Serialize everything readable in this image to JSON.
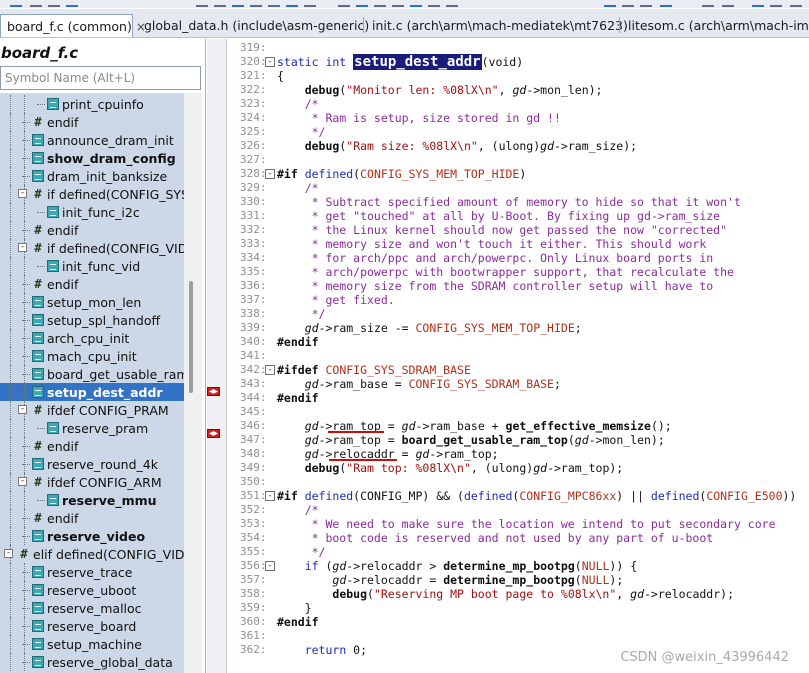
{
  "tabs": [
    {
      "label": "board_f.c (common)",
      "close": "×",
      "active": true
    },
    {
      "label": "global_data.h (include\\asm-generic)",
      "active": false
    },
    {
      "label": "init.c (arch\\arm\\mach-mediatek\\mt7623)",
      "active": false
    },
    {
      "label": "litesom.c (arch\\arm\\mach-imx\\m",
      "active": false
    }
  ],
  "symbol_panel": {
    "title": "board_f.c",
    "search_placeholder": "Symbol Name (Alt+L)",
    "items": [
      {
        "label": "print_cpuinfo",
        "kind": "function",
        "depth": 2,
        "bold": false,
        "selected": false
      },
      {
        "label": "endif",
        "kind": "preproc",
        "depth": 1,
        "bold": false,
        "selected": false
      },
      {
        "label": "announce_dram_init",
        "kind": "function",
        "depth": 1,
        "bold": false,
        "selected": false
      },
      {
        "label": "show_dram_config",
        "kind": "function",
        "depth": 1,
        "bold": true,
        "selected": false
      },
      {
        "label": "dram_init_banksize",
        "kind": "function",
        "depth": 1,
        "bold": false,
        "selected": false
      },
      {
        "label": "if defined(CONFIG_SYS_",
        "kind": "preproc",
        "depth": 1,
        "bold": false,
        "selected": false,
        "toggle": "-"
      },
      {
        "label": "init_func_i2c",
        "kind": "function",
        "depth": 2,
        "bold": false,
        "selected": false
      },
      {
        "label": "endif",
        "kind": "preproc",
        "depth": 1,
        "bold": false,
        "selected": false
      },
      {
        "label": "if defined(CONFIG_VID)",
        "kind": "preproc",
        "depth": 1,
        "bold": false,
        "selected": false,
        "toggle": "-"
      },
      {
        "label": "init_func_vid",
        "kind": "function",
        "depth": 2,
        "bold": false,
        "selected": false
      },
      {
        "label": "endif",
        "kind": "preproc",
        "depth": 1,
        "bold": false,
        "selected": false
      },
      {
        "label": "setup_mon_len",
        "kind": "function",
        "depth": 1,
        "bold": false,
        "selected": false
      },
      {
        "label": "setup_spl_handoff",
        "kind": "function",
        "depth": 1,
        "bold": false,
        "selected": false
      },
      {
        "label": "arch_cpu_init",
        "kind": "function",
        "depth": 1,
        "bold": false,
        "selected": false
      },
      {
        "label": "mach_cpu_init",
        "kind": "function",
        "depth": 1,
        "bold": false,
        "selected": false
      },
      {
        "label": "board_get_usable_ram_",
        "kind": "function",
        "depth": 1,
        "bold": false,
        "selected": false
      },
      {
        "label": "setup_dest_addr",
        "kind": "function",
        "depth": 1,
        "bold": true,
        "selected": true
      },
      {
        "label": "ifdef CONFIG_PRAM",
        "kind": "preproc",
        "depth": 1,
        "bold": false,
        "selected": false,
        "toggle": "-"
      },
      {
        "label": "reserve_pram",
        "kind": "function",
        "depth": 2,
        "bold": false,
        "selected": false
      },
      {
        "label": "endif",
        "kind": "preproc",
        "depth": 1,
        "bold": false,
        "selected": false
      },
      {
        "label": "reserve_round_4k",
        "kind": "function",
        "depth": 1,
        "bold": false,
        "selected": false
      },
      {
        "label": "ifdef CONFIG_ARM",
        "kind": "preproc",
        "depth": 1,
        "bold": false,
        "selected": false,
        "toggle": "-"
      },
      {
        "label": "reserve_mmu",
        "kind": "function",
        "depth": 2,
        "bold": true,
        "selected": false
      },
      {
        "label": "endif",
        "kind": "preproc",
        "depth": 1,
        "bold": false,
        "selected": false
      },
      {
        "label": "reserve_video",
        "kind": "function",
        "depth": 1,
        "bold": true,
        "selected": false
      },
      {
        "label": "elif defined(CONFIG_VIDEO",
        "kind": "preproc",
        "depth": 0,
        "bold": false,
        "selected": false,
        "toggle": "-"
      },
      {
        "label": "reserve_trace",
        "kind": "function",
        "depth": 1,
        "bold": false,
        "selected": false
      },
      {
        "label": "reserve_uboot",
        "kind": "function",
        "depth": 1,
        "bold": false,
        "selected": false
      },
      {
        "label": "reserve_malloc",
        "kind": "function",
        "depth": 1,
        "bold": false,
        "selected": false
      },
      {
        "label": "reserve_board",
        "kind": "function",
        "depth": 1,
        "bold": false,
        "selected": false
      },
      {
        "label": "setup_machine",
        "kind": "function",
        "depth": 1,
        "bold": false,
        "selected": false
      },
      {
        "label": "reserve_global_data",
        "kind": "function",
        "depth": 1,
        "bold": false,
        "selected": false
      }
    ]
  },
  "code": [
    {
      "n": "319:",
      "segs": []
    },
    {
      "n": "320:",
      "fold": "-",
      "segs": [
        [
          "kw",
          "static int "
        ],
        [
          "hl",
          "setup_dest_addr"
        ],
        [
          "p",
          "(void)"
        ]
      ]
    },
    {
      "n": "321:",
      "segs": [
        [
          "p",
          "{"
        ]
      ]
    },
    {
      "n": "322:",
      "segs": [
        [
          "p",
          "    "
        ],
        [
          "fn",
          "debug"
        ],
        [
          "p",
          "("
        ],
        [
          "str",
          "\"Monitor len: %08lX\\n\""
        ],
        [
          "p",
          ", "
        ],
        [
          "gd",
          "gd"
        ],
        [
          "p",
          "->mon_len);"
        ]
      ]
    },
    {
      "n": "323:",
      "segs": [
        [
          "cm",
          "    /*"
        ]
      ]
    },
    {
      "n": "324:",
      "segs": [
        [
          "cm",
          "     * Ram is setup, size stored in gd !!"
        ]
      ]
    },
    {
      "n": "325:",
      "segs": [
        [
          "cm",
          "     */"
        ]
      ]
    },
    {
      "n": "326:",
      "segs": [
        [
          "p",
          "    "
        ],
        [
          "fn",
          "debug"
        ],
        [
          "p",
          "("
        ],
        [
          "str",
          "\"Ram size: %08lX\\n\""
        ],
        [
          "p",
          ", (ulong)"
        ],
        [
          "gd",
          "gd"
        ],
        [
          "p",
          "->ram_size);"
        ]
      ]
    },
    {
      "n": "327:",
      "segs": []
    },
    {
      "n": "328:",
      "fold": "-",
      "segs": [
        [
          "dir",
          "#if "
        ],
        [
          "kw",
          "defined"
        ],
        [
          "p",
          "("
        ],
        [
          "mac",
          "CONFIG_SYS_MEM_TOP_HIDE"
        ],
        [
          "p",
          ")"
        ]
      ]
    },
    {
      "n": "329:",
      "segs": [
        [
          "cm",
          "    /*"
        ]
      ]
    },
    {
      "n": "330:",
      "segs": [
        [
          "cm",
          "     * Subtract specified amount of memory to hide so that it won't"
        ]
      ]
    },
    {
      "n": "331:",
      "segs": [
        [
          "cm",
          "     * get \"touched\" at all by U-Boot. By fixing up gd->ram_size"
        ]
      ]
    },
    {
      "n": "332:",
      "segs": [
        [
          "cm",
          "     * the Linux kernel should now get passed the now \"corrected\""
        ]
      ]
    },
    {
      "n": "333:",
      "segs": [
        [
          "cm",
          "     * memory size and won't touch it either. This should work"
        ]
      ]
    },
    {
      "n": "334:",
      "segs": [
        [
          "cm",
          "     * for arch/ppc and arch/powerpc. Only Linux board ports in"
        ]
      ]
    },
    {
      "n": "335:",
      "segs": [
        [
          "cm",
          "     * arch/powerpc with bootwrapper support, that recalculate the"
        ]
      ]
    },
    {
      "n": "336:",
      "segs": [
        [
          "cm",
          "     * memory size from the SDRAM controller setup will have to"
        ]
      ]
    },
    {
      "n": "337:",
      "segs": [
        [
          "cm",
          "     * get fixed."
        ]
      ]
    },
    {
      "n": "338:",
      "segs": [
        [
          "cm",
          "     */"
        ]
      ]
    },
    {
      "n": "339:",
      "segs": [
        [
          "p",
          "    "
        ],
        [
          "gd",
          "gd"
        ],
        [
          "p",
          "->ram_size -= "
        ],
        [
          "mac",
          "CONFIG_SYS_MEM_TOP_HIDE"
        ],
        [
          "p",
          ";"
        ]
      ]
    },
    {
      "n": "340:",
      "segs": [
        [
          "dir",
          "#endif"
        ]
      ]
    },
    {
      "n": "341:",
      "segs": []
    },
    {
      "n": "342:",
      "fold": "-",
      "segs": [
        [
          "dir",
          "#ifdef "
        ],
        [
          "mac",
          "CONFIG_SYS_SDRAM_BASE"
        ]
      ]
    },
    {
      "n": "343:",
      "segs": [
        [
          "p",
          "    "
        ],
        [
          "gd",
          "gd"
        ],
        [
          "p",
          "->ram_base = "
        ],
        [
          "mac",
          "CONFIG_SYS_SDRAM_BASE"
        ],
        [
          "p",
          ";"
        ]
      ]
    },
    {
      "n": "344:",
      "segs": [
        [
          "dir",
          "#endif"
        ]
      ]
    },
    {
      "n": "345:",
      "segs": []
    },
    {
      "n": "346:",
      "segs": [
        [
          "p",
          "    "
        ],
        [
          "gd",
          "gd"
        ],
        [
          "p",
          "->ram_top = "
        ],
        [
          "gd",
          "gd"
        ],
        [
          "p",
          "->ram_base + "
        ],
        [
          "fn",
          "get_effective_memsize"
        ],
        [
          "p",
          "();"
        ]
      ]
    },
    {
      "n": "347:",
      "segs": [
        [
          "p",
          "    "
        ],
        [
          "gd",
          "gd"
        ],
        [
          "p",
          "->ram_top = "
        ],
        [
          "fn",
          "board_get_usable_ram_top"
        ],
        [
          "p",
          "("
        ],
        [
          "gd",
          "gd"
        ],
        [
          "p",
          "->mon_len);"
        ]
      ]
    },
    {
      "n": "348:",
      "segs": [
        [
          "p",
          "    "
        ],
        [
          "gd",
          "gd"
        ],
        [
          "p",
          "->relocaddr = "
        ],
        [
          "gd",
          "gd"
        ],
        [
          "p",
          "->ram_top;"
        ]
      ]
    },
    {
      "n": "349:",
      "segs": [
        [
          "p",
          "    "
        ],
        [
          "fn",
          "debug"
        ],
        [
          "p",
          "("
        ],
        [
          "str",
          "\"Ram top: %08lX\\n\""
        ],
        [
          "p",
          ", (ulong)"
        ],
        [
          "gd",
          "gd"
        ],
        [
          "p",
          "->ram_top);"
        ]
      ]
    },
    {
      "n": "350:",
      "segs": []
    },
    {
      "n": "351:",
      "fold": "-",
      "segs": [
        [
          "dir",
          "#if "
        ],
        [
          "kw",
          "defined"
        ],
        [
          "p",
          "(CONFIG_MP) && ("
        ],
        [
          "kw",
          "defined"
        ],
        [
          "p",
          "("
        ],
        [
          "mac",
          "CONFIG_MPC86xx"
        ],
        [
          "p",
          ") || "
        ],
        [
          "kw",
          "defined"
        ],
        [
          "p",
          "("
        ],
        [
          "mac",
          "CONFIG_E500"
        ],
        [
          "p",
          "))"
        ]
      ]
    },
    {
      "n": "352:",
      "segs": [
        [
          "cm",
          "    /*"
        ]
      ]
    },
    {
      "n": "353:",
      "segs": [
        [
          "cm",
          "     * We need to make sure the location we intend to put secondary core"
        ]
      ]
    },
    {
      "n": "354:",
      "segs": [
        [
          "cm",
          "     * boot code is reserved and not used by any part of u-boot"
        ]
      ]
    },
    {
      "n": "355:",
      "segs": [
        [
          "cm",
          "     */"
        ]
      ]
    },
    {
      "n": "356:",
      "fold": "-",
      "segs": [
        [
          "p",
          "    "
        ],
        [
          "kw",
          "if"
        ],
        [
          "p",
          " ("
        ],
        [
          "gd",
          "gd"
        ],
        [
          "p",
          "->relocaddr > "
        ],
        [
          "fn",
          "determine_mp_bootpg"
        ],
        [
          "p",
          "("
        ],
        [
          "mac",
          "NULL"
        ],
        [
          "p",
          ")) {"
        ]
      ]
    },
    {
      "n": "357:",
      "segs": [
        [
          "p",
          "        "
        ],
        [
          "gd",
          "gd"
        ],
        [
          "p",
          "->relocaddr = "
        ],
        [
          "fn",
          "determine_mp_bootpg"
        ],
        [
          "p",
          "("
        ],
        [
          "mac",
          "NULL"
        ],
        [
          "p",
          ");"
        ]
      ]
    },
    {
      "n": "358:",
      "segs": [
        [
          "p",
          "        "
        ],
        [
          "fn",
          "debug"
        ],
        [
          "p",
          "("
        ],
        [
          "str",
          "\"Reserving MP boot page to %08lx\\n\""
        ],
        [
          "p",
          ", "
        ],
        [
          "gd",
          "gd"
        ],
        [
          "p",
          "->relocaddr);"
        ]
      ]
    },
    {
      "n": "359:",
      "segs": [
        [
          "p",
          "    }"
        ]
      ]
    },
    {
      "n": "360:",
      "segs": [
        [
          "dir",
          "#endif"
        ]
      ]
    },
    {
      "n": "361:",
      "segs": []
    },
    {
      "n": "362:",
      "segs": [
        [
          "p",
          "    "
        ],
        [
          "kw",
          "return"
        ],
        [
          "p",
          " 0;"
        ]
      ]
    }
  ],
  "watermark": "CSDN @weixin_43996442"
}
